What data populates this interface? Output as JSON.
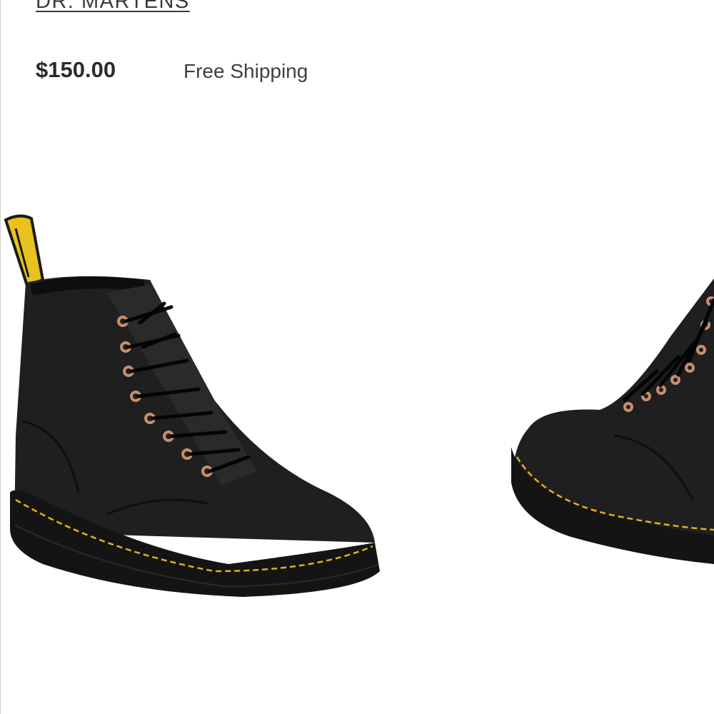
{
  "product": {
    "brand": "DR. MARTENS",
    "price": "$150.00",
    "shipping": "Free Shipping"
  },
  "image": {
    "subject": "pair of black leather 8-eye lace-up boots with yellow heel pull tab",
    "colors": {
      "leather": "#1c1c1c",
      "sole": "#141414",
      "stitching": "#e0b21a",
      "eyelets": "#c98e6e",
      "tab": "#e8c21e"
    }
  }
}
